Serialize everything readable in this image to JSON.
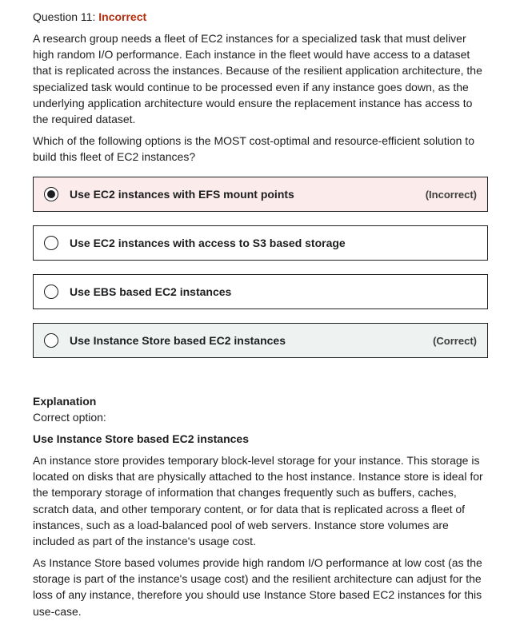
{
  "question": {
    "label": "Question 11: ",
    "status": "Incorrect",
    "prompt": "A research group needs a fleet of EC2 instances for a specialized task that must deliver high random I/O performance. Each instance in the fleet would have access to a dataset that is replicated across the instances. Because of the resilient application architecture, the specialized task would continue to be processed even if any instance goes down, as the underlying application architecture would ensure the replacement instance has access to the required dataset.",
    "ask": "Which of the following options is the MOST cost-optimal and resource-efficient solution to build this fleet of EC2 instances?"
  },
  "options": [
    {
      "label": "Use EC2 instances with EFS mount points",
      "tag": "(Incorrect)",
      "selected": true
    },
    {
      "label": "Use EC2 instances with access to S3 based storage",
      "tag": "",
      "selected": false
    },
    {
      "label": "Use EBS based EC2 instances",
      "tag": "",
      "selected": false
    },
    {
      "label": "Use Instance Store based EC2 instances",
      "tag": "(Correct)",
      "selected": false
    }
  ],
  "explanation": {
    "title": "Explanation",
    "subtitle": "Correct option:",
    "answer": "Use Instance Store based EC2 instances",
    "p1": "An instance store provides temporary block-level storage for your instance. This storage is located on disks that are physically attached to the host instance. Instance store is ideal for the temporary storage of information that changes frequently such as buffers, caches, scratch data, and other temporary content, or for data that is replicated across a fleet of instances, such as a load-balanced pool of web servers. Instance store volumes are included as part of the instance's usage cost.",
    "p2": "As Instance Store based volumes provide high random I/O performance at low cost (as the storage is part of the instance's usage cost) and the resilient architecture can adjust for the loss of any instance, therefore you should use Instance Store based EC2 instances for this use-case."
  },
  "colors": {
    "incorrect_status": "#b32d0f",
    "incorrect_bg": "#fbeceb",
    "correct_bg": "#eef3f1",
    "border": "#1c1d1f"
  }
}
